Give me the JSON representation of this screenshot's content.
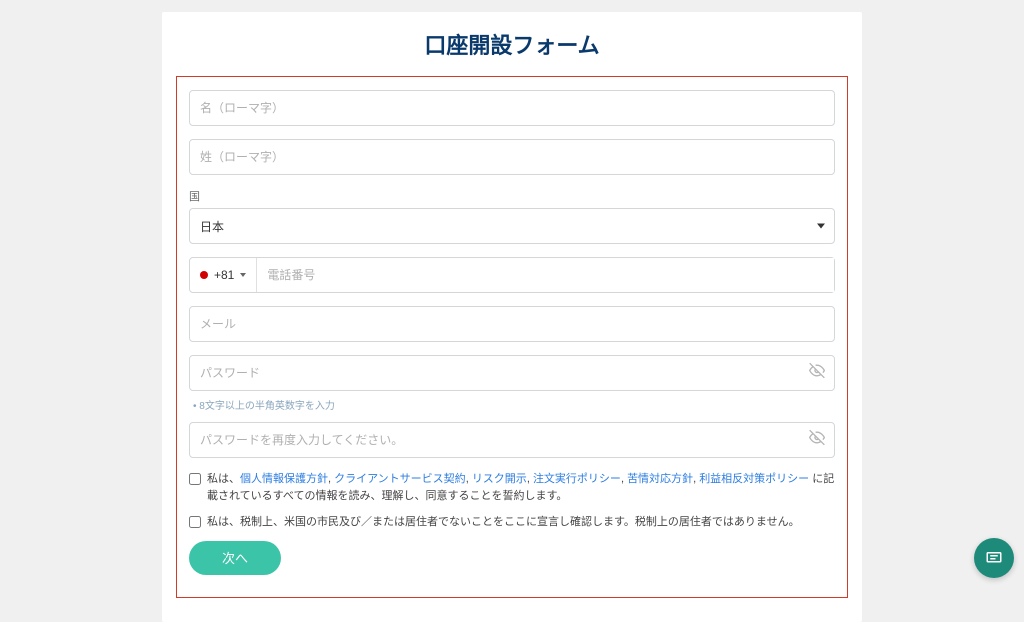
{
  "title": "口座開設フォーム",
  "fields": {
    "firstName_ph": "名（ローマ字）",
    "lastName_ph": "姓（ローマ字）",
    "country_label": "国",
    "country_value": "日本",
    "phone_prefix": "+81",
    "phone_ph": "電話番号",
    "email_ph": "メール",
    "password_ph": "パスワード",
    "password_hint": "8文字以上の半角英数字を入力",
    "password2_ph": "パスワードを再度入力してください。"
  },
  "terms": {
    "prefix": "私は、",
    "links": [
      "個人情報保護方針",
      "クライアントサービス契約",
      "リスク開示",
      "注文実行ポリシー",
      "苦情対応方針",
      "利益相反対策ポリシー"
    ],
    "suffix": " に記載されているすべての情報を読み、理解し、同意することを誓約します。"
  },
  "us_declaration": "私は、税制上、米国の市民及び／または居住者でないことをここに宣言し確認します。税制上の居住者ではありません。",
  "submit": "次へ"
}
